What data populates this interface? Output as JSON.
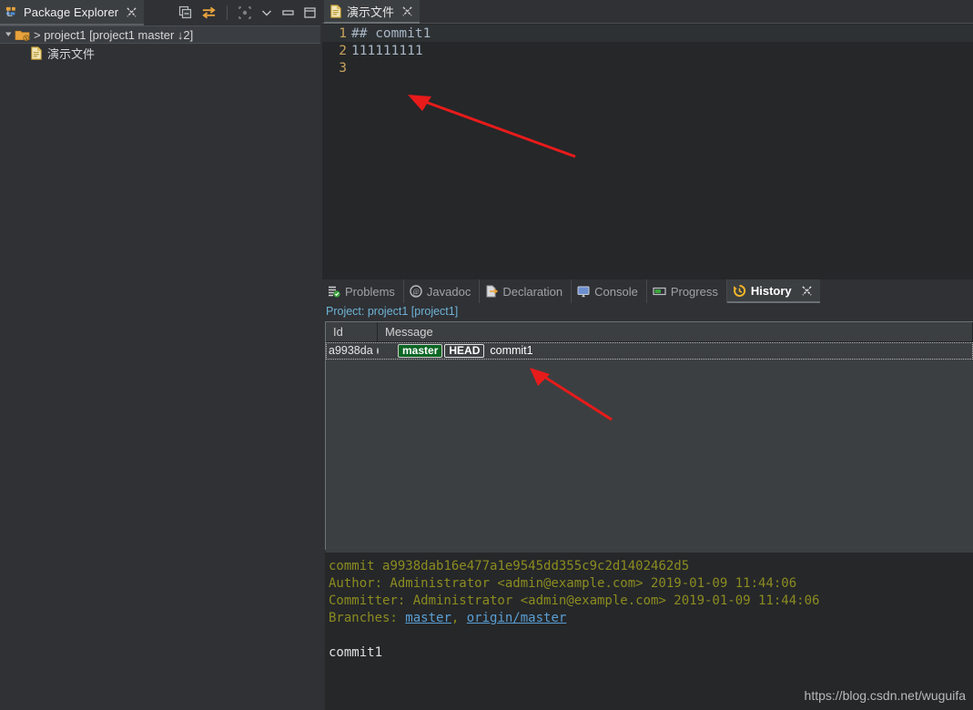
{
  "window": {
    "background": "#2f3135",
    "accent_yellow": "#e8a33d",
    "arrow_color": "#e81b1b"
  },
  "package_explorer": {
    "tab_label": "Package Explorer",
    "tab_icon": "package-explorer-icon",
    "close_icon": "close-icon",
    "toolbar": [
      {
        "name": "collapse-all-icon",
        "title": "Collapse All"
      },
      {
        "name": "link-with-editor-icon",
        "title": "Link with Editor"
      },
      {
        "name": "focus-on-active-task-icon",
        "title": "Focus on Active Task"
      },
      {
        "name": "chevron-down-icon",
        "title": "View Menu"
      },
      {
        "name": "minimize-icon",
        "title": "Minimize"
      },
      {
        "name": "maximize-icon",
        "title": "Maximize"
      }
    ],
    "tree": [
      {
        "label": "> project1 [project1 master ↓2]",
        "icon": "project-folder-icon",
        "depth": 0,
        "selected": true,
        "expanded": true
      },
      {
        "label": "演示文件",
        "icon": "file-icon",
        "depth": 1,
        "selected": false,
        "expanded": false
      }
    ]
  },
  "editor": {
    "tab_label": "演示文件",
    "tab_icon": "file-icon",
    "close_icon": "close-icon",
    "lines": [
      {
        "number": "1",
        "text": "## commit1",
        "current": true
      },
      {
        "number": "2",
        "text": "111111111",
        "current": false
      },
      {
        "number": "3",
        "text": "",
        "current": false
      }
    ]
  },
  "bottom_panel": {
    "tabs": [
      {
        "label": "Problems",
        "icon": "problems-icon",
        "active": false
      },
      {
        "label": "Javadoc",
        "icon": "javadoc-icon",
        "active": false
      },
      {
        "label": "Declaration",
        "icon": "declaration-icon",
        "active": false
      },
      {
        "label": "Console",
        "icon": "console-icon",
        "active": false
      },
      {
        "label": "Progress",
        "icon": "progress-icon",
        "active": false
      },
      {
        "label": "History",
        "icon": "history-icon",
        "active": true
      }
    ],
    "close_icon": "close-icon",
    "project_line": "Project: project1 [project1]",
    "table": {
      "columns": [
        "Id",
        "Message"
      ],
      "rows": [
        {
          "id": "a9938da",
          "badges": [
            {
              "text": "master",
              "type": "branch"
            },
            {
              "text": "HEAD",
              "type": "head"
            }
          ],
          "message": "commit1",
          "selected": true
        }
      ]
    },
    "detail": {
      "commit_label": "commit",
      "commit_hash": "a9938dab16e477a1e9545dd355c9c2d1402462d5",
      "author_line": "Author: Administrator <admin@example.com> 2019-01-09 11:44:06",
      "committer_line": "Committer: Administrator <admin@example.com> 2019-01-09 11:44:06",
      "branches_label": "Branches: ",
      "branches": [
        "master",
        "origin/master"
      ],
      "branches_separator": ", ",
      "message": "commit1"
    }
  },
  "watermark": {
    "text": "https://blog.csdn.net/wuguifa"
  },
  "annotations": {
    "arrow_editor": "red-arrow-pointing-to-code",
    "arrow_history": "red-arrow-pointing-to-commit-row"
  }
}
